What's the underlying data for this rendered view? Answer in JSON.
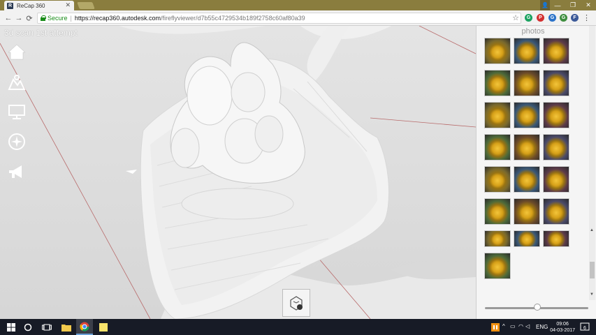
{
  "browser": {
    "tab_title": "ReCap 360",
    "tab_favicon": "R",
    "address": {
      "secure_label": "Secure",
      "url_host": "https://recap360.autodesk.com",
      "url_path": "/fireflyviewer/d7b55c4729534b189f2758c60af80a39"
    },
    "extensions": [
      "G",
      "P",
      "G",
      "G",
      "F"
    ],
    "user_icon": "person-icon"
  },
  "viewer": {
    "title": "3d scan 1st attempt",
    "tools": [
      "home-icon",
      "terrain-icon",
      "display-icon",
      "compass-icon",
      "megaphone-icon"
    ],
    "bottom_tool": "view-cube-icon"
  },
  "photos_panel": {
    "title": "photos",
    "thumbnail_rows": [
      3,
      3,
      3,
      3,
      3,
      3,
      3,
      1
    ]
  },
  "taskbar": {
    "apps": [
      "start-icon",
      "cortana-icon",
      "task-view-icon",
      "file-explorer-icon",
      "chrome-icon",
      "sticky-notes-icon"
    ],
    "tray_language": "ENG",
    "clock_time": "09:06",
    "clock_date": "04-03-2017",
    "notification_count": "6"
  },
  "colors": {
    "titlebar": "#8a7d3e",
    "taskbar": "#171b26",
    "secure_green": "#1a8d1a",
    "model_white": "#f1f1f1",
    "axis_line": "#b86a6a"
  }
}
